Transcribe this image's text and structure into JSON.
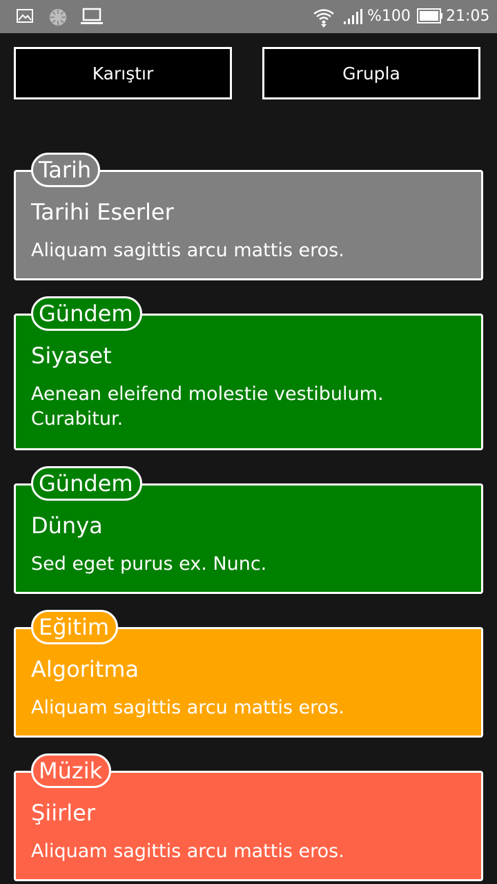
{
  "status_bar": {
    "battery": "%100",
    "time": "21:05",
    "icons": [
      "gallery-icon",
      "loading-icon",
      "laptop-icon",
      "wifi-icon",
      "signal-icon",
      "battery-icon"
    ]
  },
  "actions": {
    "shuffle_label": "Karıştır",
    "group_label": "Grupla"
  },
  "cards": [
    {
      "tag": "Tarih",
      "title": "Tarihi Eserler",
      "description": "Aliquam sagittis arcu mattis eros.",
      "color": "#808080"
    },
    {
      "tag": "Gündem",
      "title": "Siyaset",
      "description": "Aenean eleifend molestie vestibulum. Curabitur.",
      "color": "#008000"
    },
    {
      "tag": "Gündem",
      "title": "Dünya",
      "description": "Sed eget purus ex. Nunc.",
      "color": "#008000"
    },
    {
      "tag": "Eğitim",
      "title": "Algoritma",
      "description": "Aliquam sagittis arcu mattis eros.",
      "color": "#FFA500"
    },
    {
      "tag": "Müzik",
      "title": "Şiirler",
      "description": "Aliquam sagittis arcu mattis eros.",
      "color": "#FF6347"
    }
  ]
}
